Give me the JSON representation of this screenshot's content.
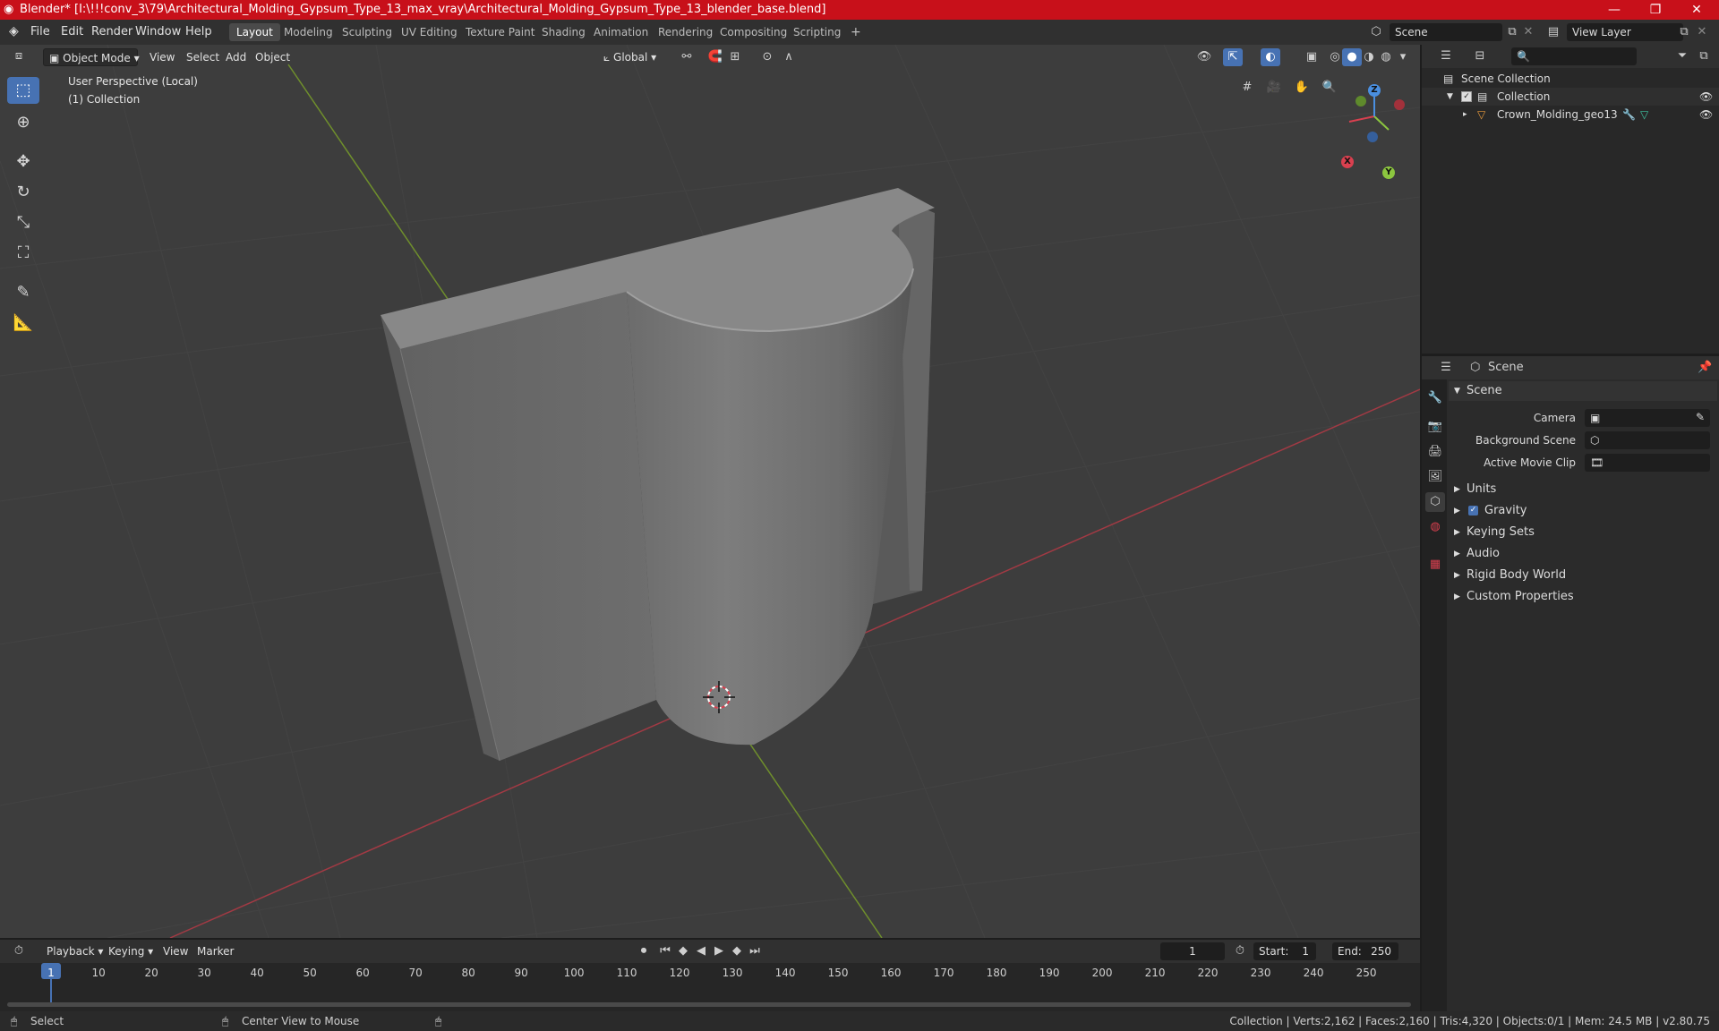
{
  "title_bar": {
    "title": "Blender* [I:\\!!!conv_3\\79\\Architectural_Molding_Gypsum_Type_13_max_vray\\Architectural_Molding_Gypsum_Type_13_blender_base.blend]",
    "minimize": "—",
    "maximize": "❐",
    "close": "✕"
  },
  "menu": {
    "file": "File",
    "edit": "Edit",
    "render": "Render",
    "window": "Window",
    "help": "Help"
  },
  "workspaces": [
    {
      "label": "Layout",
      "active": true
    },
    {
      "label": "Modeling"
    },
    {
      "label": "Sculpting"
    },
    {
      "label": "UV Editing"
    },
    {
      "label": "Texture Paint"
    },
    {
      "label": "Shading"
    },
    {
      "label": "Animation"
    },
    {
      "label": "Rendering"
    },
    {
      "label": "Compositing"
    },
    {
      "label": "Scripting"
    }
  ],
  "add_workspace": "+",
  "scene_field": "Scene",
  "view_layer_field": "View Layer",
  "viewport_header": {
    "mode": "Object Mode",
    "view": "View",
    "select": "Select",
    "add": "Add",
    "object": "Object",
    "orientation": "Global"
  },
  "viewport_overlay": {
    "perspective": "User Perspective (Local)",
    "collection": "(1) Collection"
  },
  "gizmo": {
    "x": "X",
    "y": "Y",
    "z": "Z"
  },
  "outliner": {
    "scene_collection": "Scene Collection",
    "collection": "Collection",
    "object": "Crown_Molding_geo13"
  },
  "properties": {
    "header": "Scene",
    "panel_title": "Scene",
    "camera_label": "Camera",
    "background_scene_label": "Background Scene",
    "active_movie_clip_label": "Active Movie Clip",
    "sections": [
      "Units",
      "Gravity",
      "Keying Sets",
      "Audio",
      "Rigid Body World",
      "Custom Properties"
    ],
    "gravity_checked": true
  },
  "timeline": {
    "playback": "Playback",
    "keying": "Keying",
    "view": "View",
    "marker": "Marker",
    "current_frame": "1",
    "start_label": "Start:",
    "start_value": "1",
    "end_label": "End:",
    "end_value": "250",
    "ticks": [
      "1",
      "10",
      "20",
      "30",
      "40",
      "50",
      "60",
      "70",
      "80",
      "90",
      "100",
      "110",
      "120",
      "130",
      "140",
      "150",
      "160",
      "170",
      "180",
      "190",
      "200",
      "210",
      "220",
      "230",
      "240",
      "250"
    ]
  },
  "status": {
    "select": "Select",
    "center_view": "Center View to Mouse",
    "stats": "Collection | Verts:2,162 | Faces:2,160 | Tris:4,320 | Objects:0/1 | Mem: 24.5 MB | v2.80.75"
  },
  "colors": {
    "title_bar": "#c8101a",
    "accent": "#4772b3",
    "x_axis": "#d9404f",
    "y_axis": "#8cc63f",
    "z_axis": "#4a8fe0"
  }
}
